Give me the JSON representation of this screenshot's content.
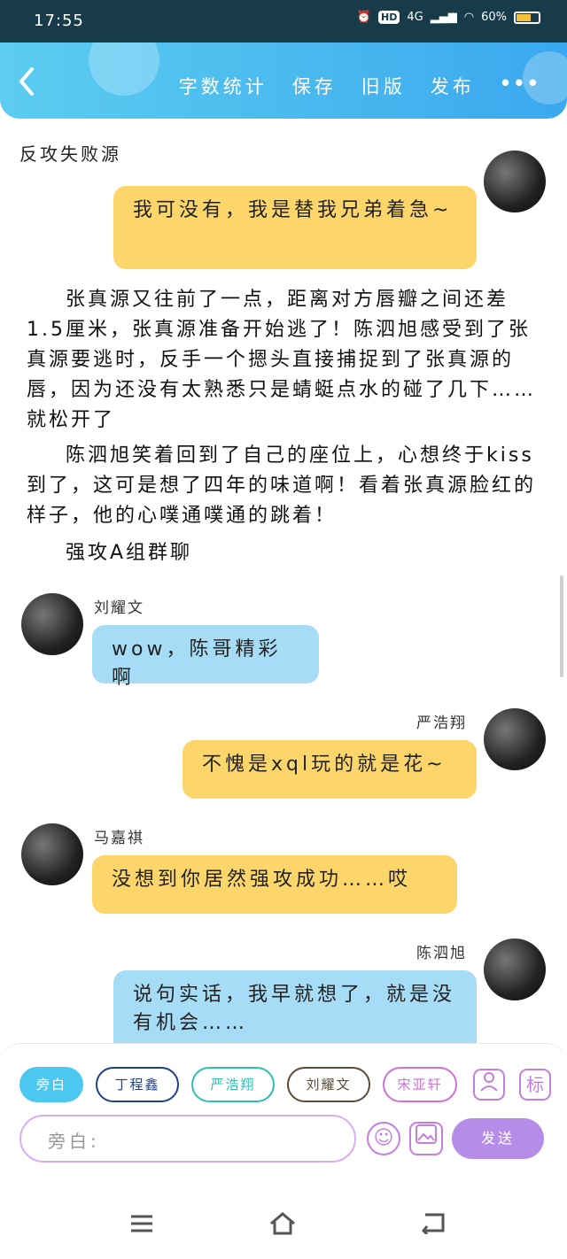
{
  "status_bar": {
    "time": "17:55",
    "hd": "HD",
    "network": "4G",
    "battery": "60%"
  },
  "header": {
    "back_icon": "chevron-left-icon",
    "actions": {
      "word_count": "字数统计",
      "save": "保存",
      "old_version": "旧版",
      "publish": "发布"
    },
    "more_icon": "more-dots-icon"
  },
  "story": {
    "title": "反攻失败源",
    "messages": [
      {
        "side": "right",
        "name": "",
        "text": "我可没有，我是替我兄弟着急~"
      }
    ],
    "paragraphs": [
      "张真源又往前了一点，距离对方唇瓣之间还差1.5厘米，张真源准备开始逃了！陈泗旭感受到了张真源要逃时，反手一个摁头直接捕捉到了张真源的唇，因为还没有太熟悉只是蜻蜓点水的碰了几下……就松开了",
      "陈泗旭笑着回到了自己的座位上，心想终于kiss到了，这可是想了四年的味道啊！看着张真源脸红的样子，他的心噗通噗通的跳着！",
      "强攻A组群聊"
    ],
    "chat": [
      {
        "side": "left",
        "name": "刘耀文",
        "text": "wow，陈哥精彩啊"
      },
      {
        "side": "right",
        "name": "严浩翔",
        "text": "不愧是xql玩的就是花~"
      },
      {
        "side": "left",
        "name": "马嘉祺",
        "text": "没想到你居然强攻成功……哎"
      },
      {
        "side": "right",
        "name": "陈泗旭",
        "text": "说句实话，我早就想了，就是没有机会……"
      }
    ]
  },
  "composer": {
    "chips": [
      "旁白",
      "丁程鑫",
      "严浩翔",
      "刘耀文",
      "宋亚轩"
    ],
    "chip_colors": [
      "#4cc8f0",
      "#1f3f8a",
      "#2fbfb0",
      "#5a4a3a",
      "#d070d8"
    ],
    "tag_label": "标",
    "placeholder": "旁白:",
    "send_label": "发送",
    "emoji_icon": "smiley-icon",
    "image_icon": "image-icon",
    "character_icon": "character-icon"
  },
  "nav": {
    "menu_icon": "menu-icon",
    "home_icon": "home-icon",
    "back_icon": "back-icon"
  }
}
